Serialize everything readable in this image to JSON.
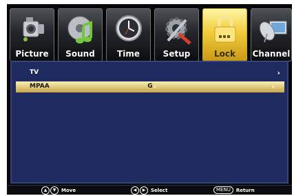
{
  "tabs": [
    {
      "label": "Picture",
      "icon": "camera-icon",
      "active": false
    },
    {
      "label": "Sound",
      "icon": "music-note-icon",
      "active": false
    },
    {
      "label": "Time",
      "icon": "clock-icon",
      "active": false
    },
    {
      "label": "Setup",
      "icon": "gear-tools-icon",
      "active": false
    },
    {
      "label": "Lock",
      "icon": "padlock-icon",
      "active": true
    },
    {
      "label": "Channel",
      "icon": "satellite-dish-icon",
      "active": false
    }
  ],
  "menu": {
    "rows": [
      {
        "label": "TV",
        "value": "",
        "selected": false
      },
      {
        "label": "MPAA",
        "value": "G",
        "selected": true
      }
    ]
  },
  "footer": {
    "move": "Move",
    "select": "Select",
    "menu_key": "MENU",
    "return": "Return"
  },
  "colors": {
    "panel": "#1f2a5e",
    "active_tab": "#f2cc3a",
    "selected_row": "#e6d48a"
  }
}
